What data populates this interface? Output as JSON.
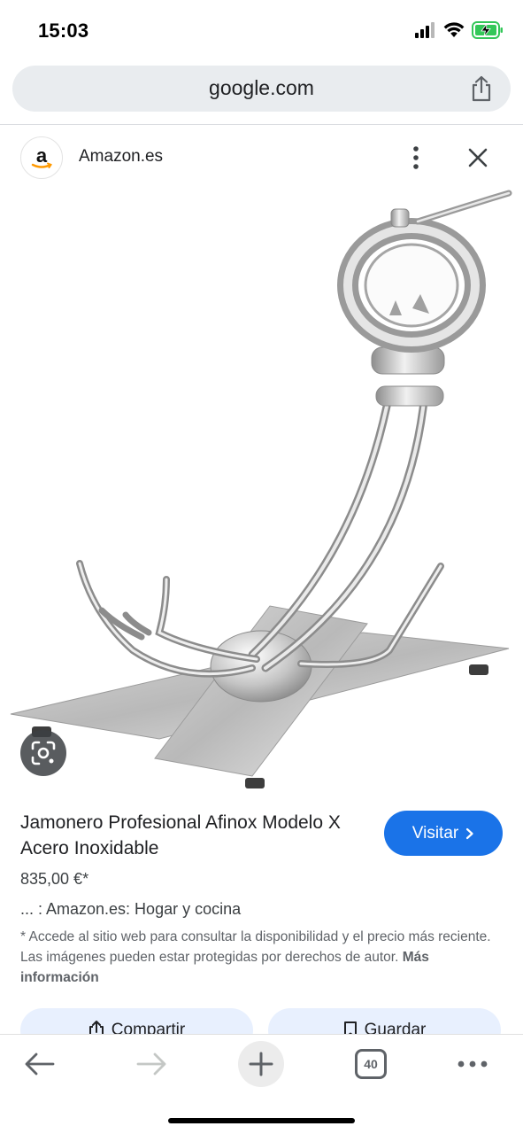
{
  "status_bar": {
    "time": "15:03",
    "icons": [
      "signal-icon",
      "wifi-icon",
      "battery-charging-icon"
    ]
  },
  "browser": {
    "url": "google.com",
    "open_tabs": "40"
  },
  "source": {
    "logo_letter": "a",
    "name": "Amazon.es"
  },
  "product": {
    "title": "Jamonero Profesional Afinox Modelo X Acero Inoxidable",
    "price": "835,00 €*",
    "category": "... : Amazon.es: Hogar y cocina",
    "disclaimer": "* Accede al sitio web para consultar la disponibilidad y el precio más reciente. Las imágenes pueden estar protegidas por derechos de autor.",
    "more_info": "Más información"
  },
  "buttons": {
    "visit": "Visitar",
    "share": "Compartir",
    "save": "Guardar"
  },
  "colors": {
    "accent": "#1a73e8",
    "battery": "#34c759",
    "action_bg": "#e8f0fe"
  }
}
